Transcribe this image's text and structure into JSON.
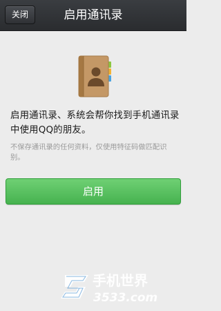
{
  "header": {
    "close_label": "关闭",
    "title": "启用通讯录"
  },
  "main": {
    "icon": "contacts-book-icon",
    "description": "启用通讯录、系统会帮你找到手机通讯录中使用QQ的朋友。",
    "note": "不保存通讯录的任何资料，仅使用特征码做匹配识别。",
    "enable_label": "启用"
  },
  "watermark": {
    "name": "手机世界",
    "site": "3533.com"
  },
  "colors": {
    "topbar": "#2f3236",
    "background": "#ececec",
    "button_green": "#5cc062"
  }
}
